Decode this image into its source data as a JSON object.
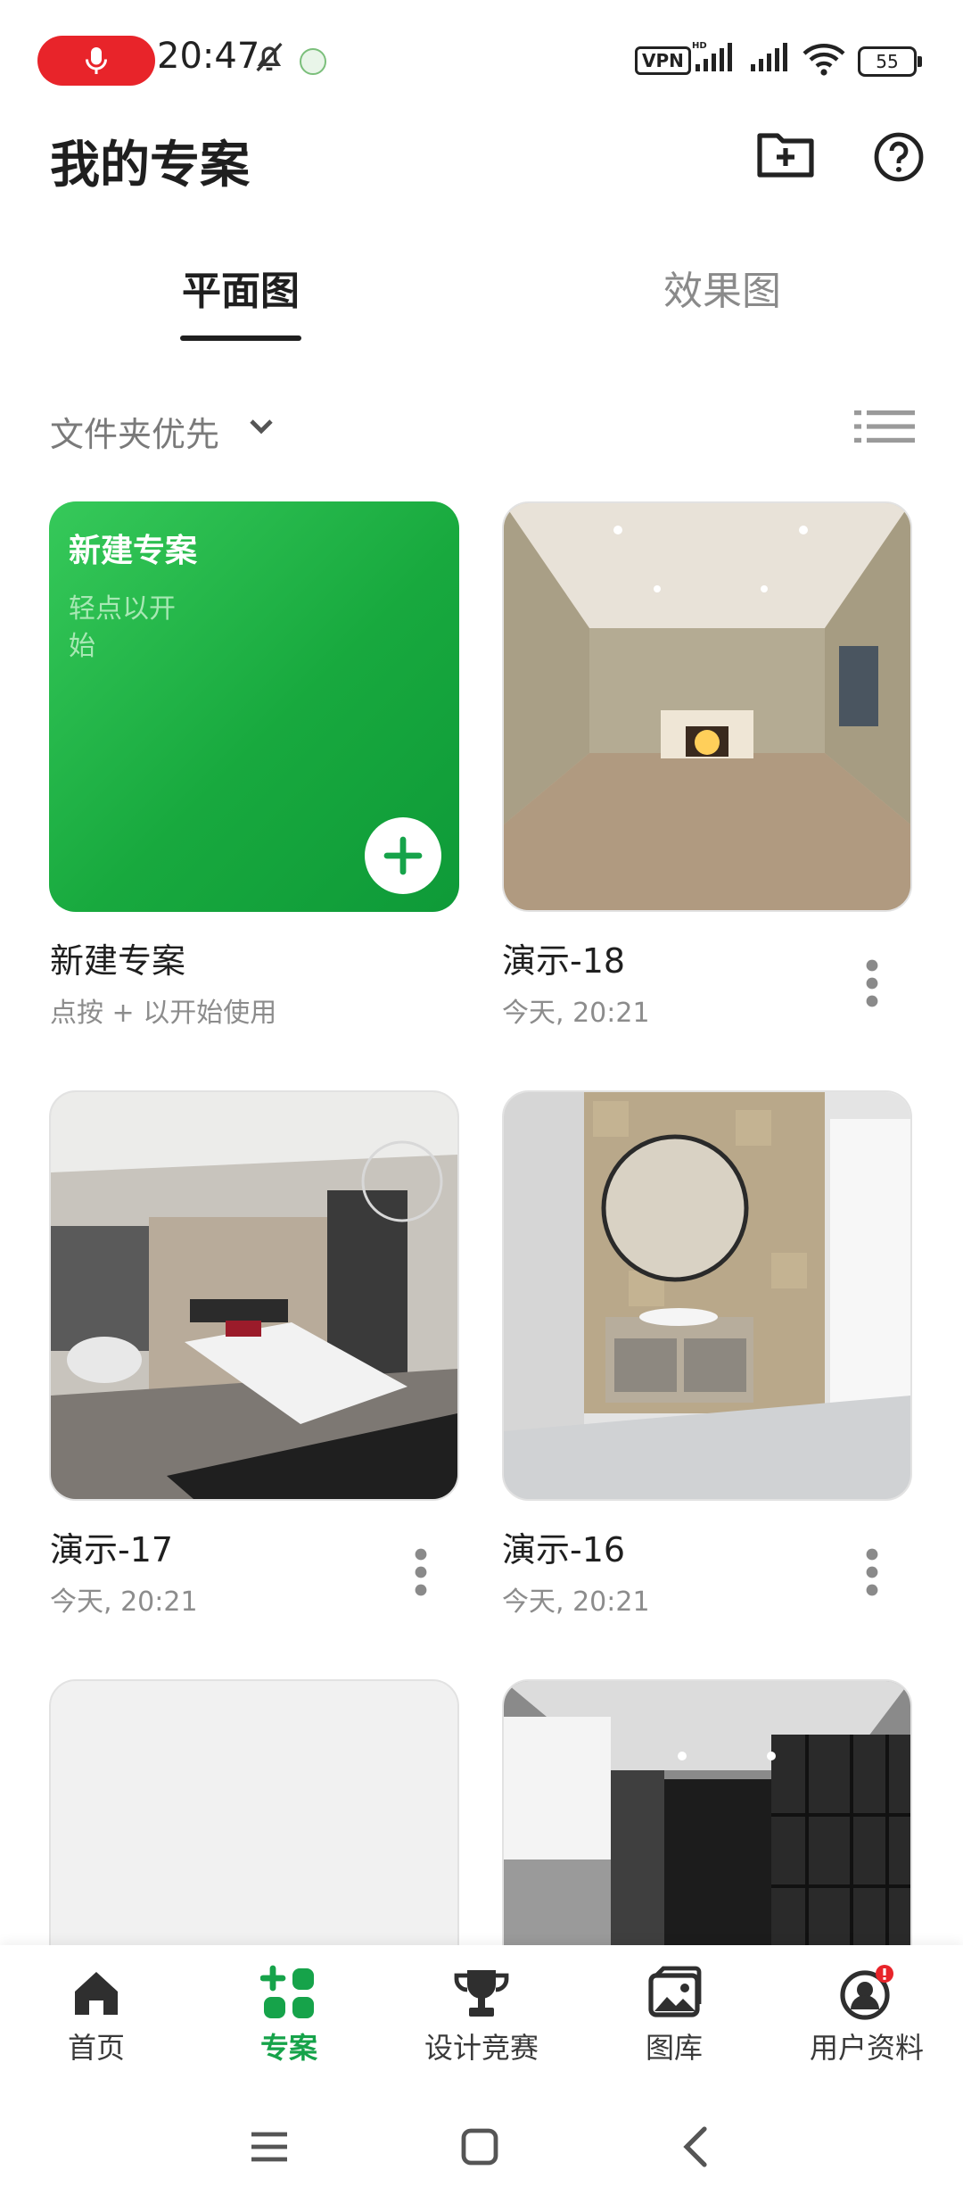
{
  "status_bar": {
    "time": "20:47",
    "vpn": "VPN",
    "battery": "55",
    "icons": [
      "microphone-icon",
      "bell-off-icon",
      "app-icon",
      "vpn-icon",
      "signal-hd-icon",
      "signal-icon",
      "wifi-icon",
      "battery-icon"
    ]
  },
  "header": {
    "title": "我的专案",
    "icons": [
      "new-folder-icon",
      "help-icon"
    ]
  },
  "tabs": [
    {
      "label": "平面图",
      "active": true
    },
    {
      "label": "效果图",
      "active": false
    }
  ],
  "sort": {
    "label": "文件夹优先",
    "icons": [
      "chevron-down-icon",
      "list-view-icon"
    ]
  },
  "new_project": {
    "card_title": "新建专案",
    "card_hint": "轻点以开始",
    "name": "新建专案",
    "meta": "点按 + 以开始使用"
  },
  "projects": [
    {
      "name": "演示-18",
      "meta": "今天, 20:21"
    },
    {
      "name": "演示-17",
      "meta": "今天, 20:21"
    },
    {
      "name": "演示-16",
      "meta": "今天, 20:21"
    }
  ],
  "bottom_nav": [
    {
      "label": "首页",
      "icon": "home-icon",
      "active": false
    },
    {
      "label": "专案",
      "icon": "projects-icon",
      "active": true
    },
    {
      "label": "设计竞赛",
      "icon": "trophy-icon",
      "active": false
    },
    {
      "label": "图库",
      "icon": "gallery-icon",
      "active": false
    },
    {
      "label": "用户资料",
      "icon": "profile-icon",
      "active": false
    }
  ],
  "colors": {
    "accent": "#16a34a",
    "new_card": "#1db846",
    "alert": "#e8242a"
  }
}
